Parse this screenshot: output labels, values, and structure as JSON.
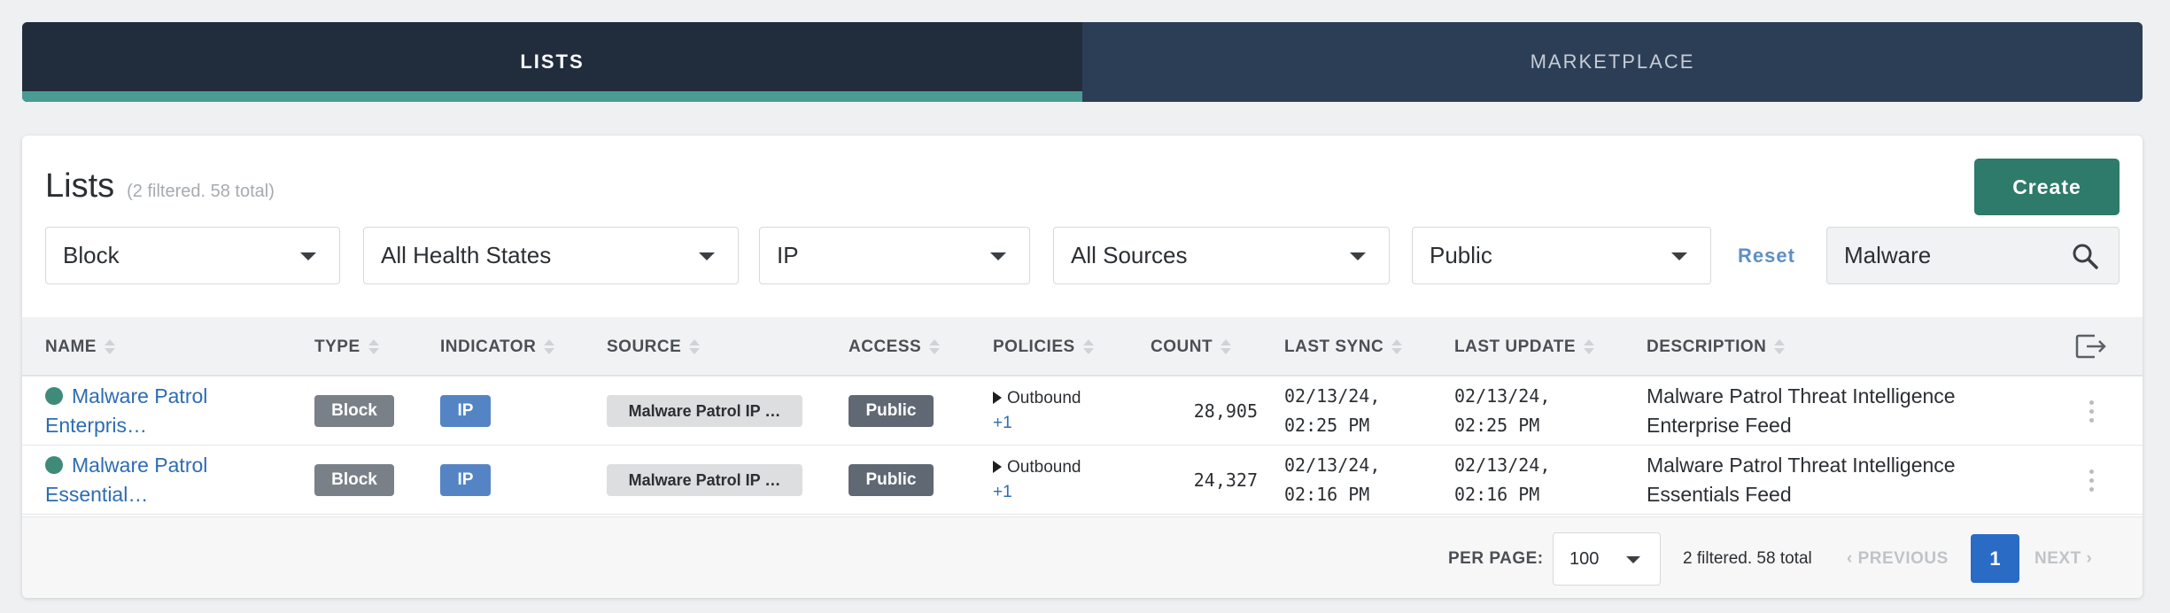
{
  "tabs": [
    {
      "label": "LISTS",
      "active": true
    },
    {
      "label": "MARKETPLACE",
      "active": false
    }
  ],
  "header": {
    "title": "Lists",
    "subtitle": "(2 filtered. 58 total)",
    "create_label": "Create"
  },
  "filters": {
    "type": "Block",
    "health": "All Health States",
    "indicator": "IP",
    "sources": "All Sources",
    "access": "Public",
    "reset_label": "Reset",
    "search_value": "Malware"
  },
  "table": {
    "columns": [
      "NAME",
      "TYPE",
      "INDICATOR",
      "SOURCE",
      "ACCESS",
      "POLICIES",
      "COUNT",
      "LAST SYNC",
      "LAST UPDATE",
      "DESCRIPTION"
    ],
    "rows": [
      {
        "name_line1": "Malware Patrol",
        "name_line2": "Enterpris…",
        "type": "Block",
        "indicator": "IP",
        "source": "Malware Patrol IP …",
        "access": "Public",
        "policy": "Outbound",
        "policy_more": "+1",
        "count": "28,905",
        "last_sync_date": "02/13/24,",
        "last_sync_time": "02:25 PM",
        "last_update_date": "02/13/24,",
        "last_update_time": "02:25 PM",
        "desc_line1": "Malware Patrol Threat Intelligence",
        "desc_line2": "Enterprise Feed"
      },
      {
        "name_line1": "Malware Patrol",
        "name_line2": "Essential…",
        "type": "Block",
        "indicator": "IP",
        "source": "Malware Patrol IP …",
        "access": "Public",
        "policy": "Outbound",
        "policy_more": "+1",
        "count": "24,327",
        "last_sync_date": "02/13/24,",
        "last_sync_time": "02:16 PM",
        "last_update_date": "02/13/24,",
        "last_update_time": "02:16 PM",
        "desc_line1": "Malware Patrol Threat Intelligence",
        "desc_line2": "Essentials Feed"
      }
    ]
  },
  "footer": {
    "per_page_label": "PER PAGE:",
    "per_page_value": "100",
    "summary": "2 filtered. 58 total",
    "previous_label": "PREVIOUS",
    "page": "1",
    "next_label": "NEXT"
  },
  "icons": {
    "search": "search-icon",
    "export": "export-icon",
    "status": "health-status-dot",
    "kebab": "kebab-menu-icon"
  },
  "colors": {
    "accent_teal": "#2e7a6b",
    "tab_active_bg": "#212d3d",
    "tab_inactive_bg": "#2c3e55",
    "link_blue": "#2d6cb5",
    "page_active": "#2a6bc5"
  }
}
